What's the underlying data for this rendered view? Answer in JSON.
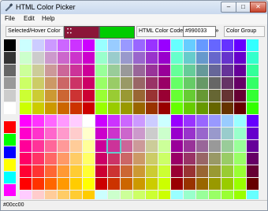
{
  "window": {
    "title": "HTML Color Picker"
  },
  "menu": {
    "items": [
      "File",
      "Edit",
      "Help"
    ]
  },
  "toolbar": {
    "selected_hover_label": "Selected/Hover Color",
    "selected_color": "#8b1538",
    "hover_color": "#00cc00",
    "html_code_label": "HTML Color Code",
    "html_code_value": "#990033",
    "expand_label": "»",
    "color_group_label": "Color Group"
  },
  "grays": [
    "#000000",
    "#333333",
    "#666666",
    "#999999",
    "#cccccc",
    "#ffffff"
  ],
  "primaries": [
    "#ff0000",
    "#00ff00",
    "#0000ff",
    "#ffff00",
    "#00ffff",
    "#ff00ff"
  ],
  "grid_rows": [
    [
      "#ccffff",
      "#ccccff",
      "#cc99ff",
      "#cc66ff",
      "#cc33ff",
      "#cc00ff",
      "#99ffff",
      "#99ccff",
      "#9999ff",
      "#9966ff",
      "#9933ff",
      "#9900ff",
      "#66ffff",
      "#66ccff",
      "#6699ff",
      "#6666ff",
      "#6633ff",
      "#6600ff"
    ],
    [
      "#ccffcc",
      "#cccccc",
      "#cc99cc",
      "#cc66cc",
      "#cc33cc",
      "#cc00cc",
      "#99ffcc",
      "#99cccc",
      "#9999cc",
      "#9966cc",
      "#9933cc",
      "#9900cc",
      "#66ffcc",
      "#66cccc",
      "#6699cc",
      "#6666cc",
      "#6633cc",
      "#6600cc"
    ],
    [
      "#ccff99",
      "#cccc99",
      "#cc9999",
      "#cc6699",
      "#cc3399",
      "#cc0099",
      "#99ff99",
      "#99cc99",
      "#999999",
      "#996699",
      "#993399",
      "#990099",
      "#66ff99",
      "#66cc99",
      "#669999",
      "#666699",
      "#663399",
      "#660099"
    ],
    [
      "#ccff66",
      "#cccc66",
      "#cc9966",
      "#cc6666",
      "#cc3366",
      "#cc0066",
      "#99ff66",
      "#99cc66",
      "#999966",
      "#996666",
      "#993366",
      "#990066",
      "#66ff66",
      "#66cc66",
      "#669966",
      "#666666",
      "#663366",
      "#660066"
    ],
    [
      "#ccff33",
      "#cccc33",
      "#cc9933",
      "#cc6633",
      "#cc3333",
      "#cc0033",
      "#99ff33",
      "#99cc33",
      "#999933",
      "#996633",
      "#993333",
      "#990033",
      "#66ff33",
      "#66cc33",
      "#669933",
      "#666633",
      "#663333",
      "#660033"
    ],
    [
      "#ccff00",
      "#cccc00",
      "#cc9900",
      "#cc6600",
      "#cc3300",
      "#cc0000",
      "#99ff00",
      "#99cc00",
      "#999900",
      "#996600",
      "#993300",
      "#990000",
      "#66ff00",
      "#66cc00",
      "#669900",
      "#666600",
      "#663300",
      "#660000"
    ],
    [
      "#ff00ff",
      "#ff33ff",
      "#ff66ff",
      "#ff99ff",
      "#ffccff",
      "#ffffff",
      "#cc00ff",
      "#cc33ff",
      "#cc66ff",
      "#cc99ff",
      "#ccccff",
      "#ccffff",
      "#9900ff",
      "#9933ff",
      "#9966ff",
      "#9999ff",
      "#99ccff",
      "#99ffff"
    ],
    [
      "#ff00cc",
      "#ff33cc",
      "#ff66cc",
      "#ff99cc",
      "#ffcccc",
      "#ffffcc",
      "#cc00cc",
      "#cc33cc",
      "#cc66cc",
      "#cc99cc",
      "#cccccc",
      "#ccffcc",
      "#9900cc",
      "#9933cc",
      "#9966cc",
      "#9999cc",
      "#99cccc",
      "#99ffcc"
    ],
    [
      "#ff0099",
      "#ff3399",
      "#ff6699",
      "#ff9999",
      "#ffcc99",
      "#ffff99",
      "#cc0099",
      "#cc3399",
      "#cc6699",
      "#cc9999",
      "#cccc99",
      "#ccff99",
      "#990099",
      "#993399",
      "#996699",
      "#999999",
      "#99cc99",
      "#99ff99"
    ],
    [
      "#ff0066",
      "#ff3366",
      "#ff6666",
      "#ff9966",
      "#ffcc66",
      "#ffff66",
      "#cc0066",
      "#cc3366",
      "#cc6666",
      "#cc9966",
      "#cccc66",
      "#ccff66",
      "#990066",
      "#993366",
      "#996666",
      "#999966",
      "#99cc66",
      "#99ff66"
    ],
    [
      "#ff0033",
      "#ff3333",
      "#ff6633",
      "#ff9933",
      "#ffcc33",
      "#ffff33",
      "#cc0033",
      "#cc3333",
      "#cc6633",
      "#cc9933",
      "#cccc33",
      "#ccff33",
      "#990033",
      "#993333",
      "#996633",
      "#999933",
      "#99cc33",
      "#99ff33"
    ],
    [
      "#ff0000",
      "#ff3300",
      "#ff6600",
      "#ff9900",
      "#ffcc00",
      "#ffff00",
      "#cc0000",
      "#cc3300",
      "#cc6600",
      "#cc9900",
      "#cccc00",
      "#ccff00",
      "#990000",
      "#993300",
      "#996600",
      "#999900",
      "#99cc00",
      "#99ff00"
    ],
    [
      "#ffccff",
      "#ffcccc",
      "#ffcc99",
      "#ffcc66",
      "#ffcc33",
      "#ffcc00",
      "#ccffff",
      "#ccffcc",
      "#ccff99",
      "#ccff66",
      "#ccff33",
      "#ccff00",
      "#99ffff",
      "#99ffcc",
      "#99ff99",
      "#99ff66",
      "#99ff33",
      "#99ff00"
    ]
  ],
  "grid_rows_right": [
    [
      "#33ffff",
      "#00ffff",
      "#00ccff",
      "#0099ff",
      "#0066ff",
      "#0033ff",
      "#0000ff",
      "#3300ff"
    ],
    [
      "#33ffcc",
      "#00ffcc",
      "#00cccc",
      "#0099cc",
      "#0066cc",
      "#0033cc",
      "#0000cc",
      "#3300cc"
    ],
    [
      "#33ff99",
      "#00ff99",
      "#00cc99",
      "#009999",
      "#006699",
      "#003399",
      "#000099",
      "#330099"
    ],
    [
      "#33ff66",
      "#00ff66",
      "#00cc66",
      "#009966",
      "#006666",
      "#003366",
      "#000066",
      "#330066"
    ],
    [
      "#33ff33",
      "#00ff33",
      "#00cc33",
      "#009933",
      "#006633",
      "#003333",
      "#000033",
      "#330033"
    ],
    [
      "#33ff00",
      "#00ff00",
      "#00cc00",
      "#009900",
      "#006600",
      "#003300",
      "#000000",
      "#330000"
    ],
    [
      "#6600ff",
      "#6633ff",
      "#6666ff",
      "#6699ff",
      "#66ccff",
      "#66ffff",
      "#3300ff",
      "#0000ff"
    ],
    [
      "#6600cc",
      "#6633cc",
      "#6666cc",
      "#6699cc",
      "#66cccc",
      "#66ffcc",
      "#3300cc",
      "#0000cc"
    ],
    [
      "#660099",
      "#663399",
      "#666699",
      "#669999",
      "#66cc99",
      "#66ff99",
      "#330099",
      "#000099"
    ],
    [
      "#660066",
      "#663366",
      "#666666",
      "#669966",
      "#66cc66",
      "#66ff66",
      "#330066",
      "#000066"
    ],
    [
      "#660033",
      "#663333",
      "#666633",
      "#669933",
      "#66cc33",
      "#66ff33",
      "#330033",
      "#000033"
    ],
    [
      "#660000",
      "#663300",
      "#666600",
      "#669900",
      "#66cc00",
      "#66ff00",
      "#330000",
      "#000000"
    ],
    [
      "#66ffff",
      "#66ffcc",
      "#66ff99",
      "#66ff66",
      "#66ff33",
      "#66ff00",
      "#33ff33",
      "#00ff00"
    ]
  ],
  "selected_cell": {
    "row": 8,
    "col": 7
  },
  "status": {
    "text": "#00cc00"
  }
}
